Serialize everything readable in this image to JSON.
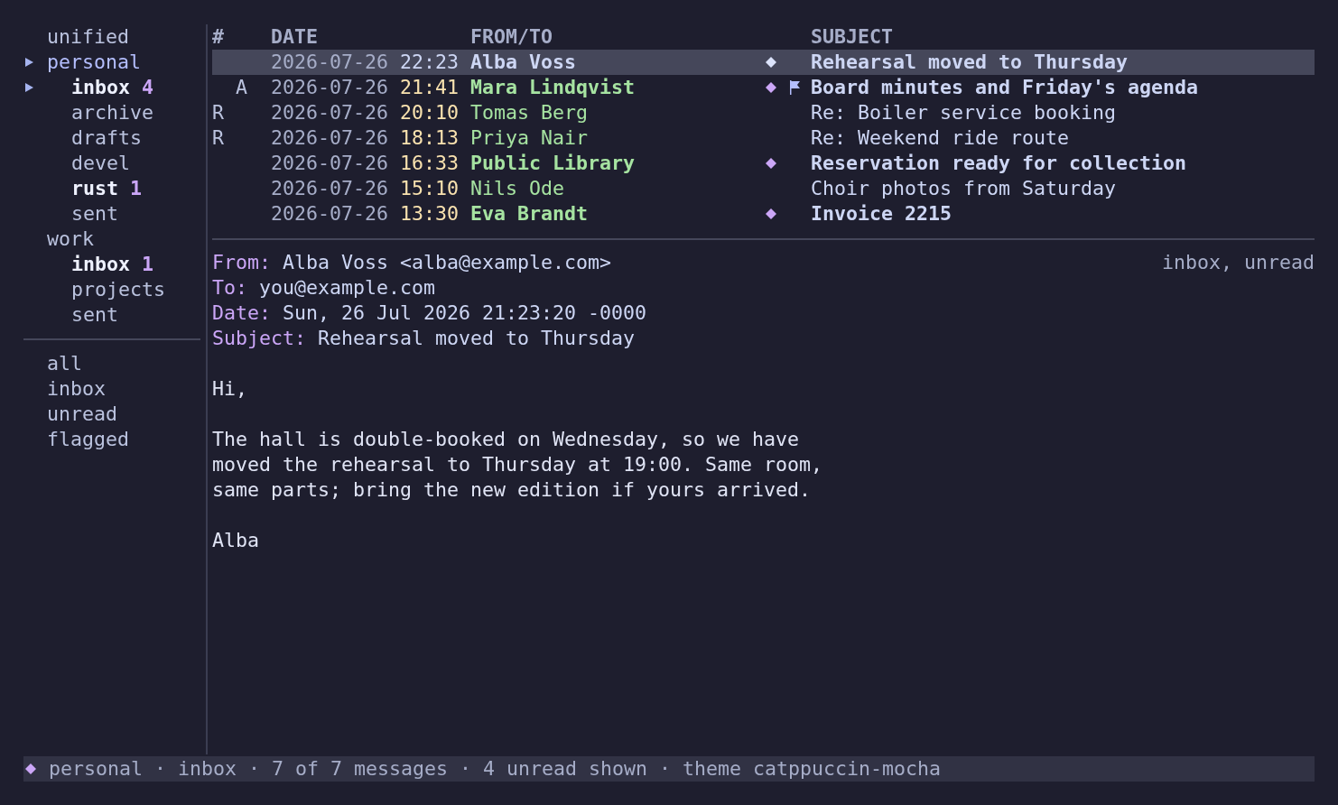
{
  "sidebar": {
    "folders": [
      {
        "label": "unified",
        "current": false,
        "unread": false
      },
      {
        "label": "personal",
        "current": true,
        "unread": false,
        "children": [
          {
            "label": "inbox",
            "count": "4",
            "unread": true,
            "current": true
          },
          {
            "label": "archive",
            "unread": false,
            "current": false
          },
          {
            "label": "drafts",
            "unread": false,
            "current": false
          },
          {
            "label": "devel",
            "unread": false,
            "current": false
          },
          {
            "label": "rust",
            "count": "1",
            "unread": true,
            "current": false
          },
          {
            "label": "sent",
            "unread": false,
            "current": false
          }
        ]
      },
      {
        "label": "work",
        "current": false,
        "unread": false,
        "children": [
          {
            "label": "inbox",
            "count": "1",
            "unread": true,
            "current": false
          },
          {
            "label": "projects",
            "unread": false,
            "current": false
          },
          {
            "label": "sent",
            "unread": false,
            "current": false
          }
        ]
      }
    ],
    "views": [
      {
        "label": "all"
      },
      {
        "label": "inbox"
      },
      {
        "label": "unread"
      },
      {
        "label": "flagged"
      }
    ]
  },
  "message_list": {
    "columns": [
      "#",
      "DATE",
      "FROM/TO",
      "SUBJECT"
    ],
    "rows": [
      {
        "date": "2026-07-26",
        "time": "22:23",
        "from": "Alba Voss",
        "subject": "Rehearsal moved to Thursday",
        "unread": true,
        "flagged": false,
        "selected": true
      },
      {
        "attachment_mark": "A",
        "date": "2026-07-26",
        "time": "21:41",
        "from": "Mara Lindqvist",
        "subject": "Board minutes and Friday's agenda",
        "unread": true,
        "flagged": true,
        "selected": false
      },
      {
        "replied_mark": "R",
        "date": "2026-07-26",
        "time": "20:10",
        "from": "Tomas Berg",
        "subject": "Re: Boiler service booking",
        "unread": false,
        "flagged": false,
        "selected": false
      },
      {
        "replied_mark": "R",
        "date": "2026-07-26",
        "time": "18:13",
        "from": "Priya Nair",
        "subject": "Re: Weekend ride route",
        "unread": false,
        "flagged": false,
        "selected": false
      },
      {
        "date": "2026-07-26",
        "time": "16:33",
        "from": "Public Library",
        "subject": "Reservation ready for collection",
        "unread": true,
        "flagged": false,
        "selected": false
      },
      {
        "date": "2026-07-26",
        "time": "15:10",
        "from": "Nils Ode",
        "subject": "Choir photos from Saturday",
        "unread": false,
        "flagged": false,
        "selected": false
      },
      {
        "date": "2026-07-26",
        "time": "13:30",
        "from": "Eva Brandt",
        "subject": "Invoice 2215",
        "unread": true,
        "flagged": false,
        "selected": false
      }
    ]
  },
  "preview": {
    "headers": [
      {
        "label": "From:",
        "value": "Alba Voss <alba@example.com>"
      },
      {
        "label": "To:",
        "value": "you@example.com"
      },
      {
        "label": "Date:",
        "value": "Sun, 26 Jul 2026 21:23:20 -0000"
      },
      {
        "label": "Subject:",
        "value": "Rehearsal moved to Thursday"
      }
    ],
    "tags": "inbox, unread",
    "body": [
      "Hi,",
      "The hall is double-booked on Wednesday, so we have\nmoved the rehearsal to Thursday at 19:00. Same room,\nsame parts; bring the new edition if yours arrived.",
      "Alba"
    ]
  },
  "status_bar": {
    "text": "personal · inbox · 7 of 7 messages · 4 unread shown · theme catppuccin-mocha"
  }
}
